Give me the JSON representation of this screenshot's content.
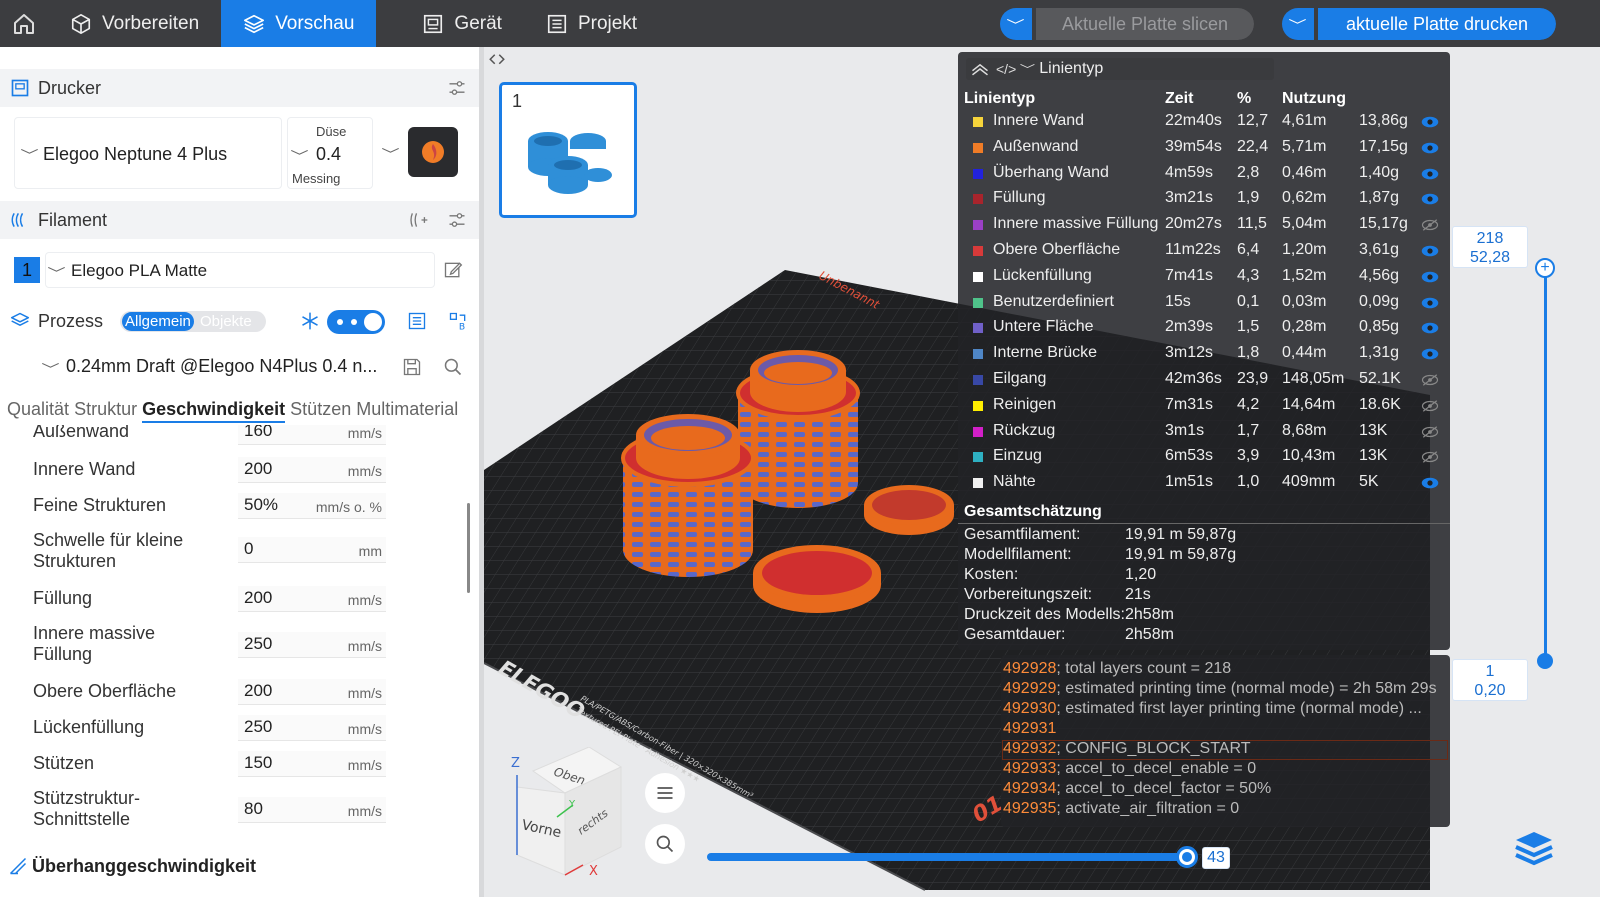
{
  "topbar": {
    "tabs": [
      {
        "label": "Vorbereiten",
        "active": false
      },
      {
        "label": "Vorschau",
        "active": true
      },
      {
        "label": "Gerät",
        "active": false
      },
      {
        "label": "Projekt",
        "active": false
      }
    ],
    "slice_label": "Aktuelle Platte slicen",
    "print_label": "aktuelle Platte drucken"
  },
  "printer": {
    "title": "Drucker",
    "name": "Elegoo Neptune 4 Plus",
    "nozzle_label": "Düse",
    "nozzle_value": "0.4",
    "nozzle_material": "Messing"
  },
  "filament": {
    "title": "Filament",
    "slot": "1",
    "name": "Elegoo PLA Matte"
  },
  "process": {
    "title": "Prozess",
    "mode_global": "Allgemein",
    "mode_objects": "Objekte",
    "profile": "0.24mm Draft @Elegoo N4Plus 0.4 n...",
    "tabs": [
      {
        "label": "Qualität",
        "active": false
      },
      {
        "label": "Struktur",
        "active": false
      },
      {
        "label": "Geschwindigkeit",
        "active": true
      },
      {
        "label": "Stützen",
        "active": false
      },
      {
        "label": "Multimaterial",
        "active": false
      }
    ],
    "settings": [
      {
        "label": "Außenwand",
        "value": "160",
        "unit": "mm/s"
      },
      {
        "label": "Innere Wand",
        "value": "200",
        "unit": "mm/s"
      },
      {
        "label": "Feine Strukturen",
        "value": "50%",
        "unit": "mm/s o. %"
      },
      {
        "label": "Schwelle für kleine Strukturen",
        "value": "0",
        "unit": "mm"
      },
      {
        "label": "Füllung",
        "value": "200",
        "unit": "mm/s"
      },
      {
        "label": "Innere massive Füllung",
        "value": "250",
        "unit": "mm/s"
      },
      {
        "label": "Obere Oberfläche",
        "value": "200",
        "unit": "mm/s"
      },
      {
        "label": "Lückenfüllung",
        "value": "250",
        "unit": "mm/s"
      },
      {
        "label": "Stützen",
        "value": "150",
        "unit": "mm/s"
      },
      {
        "label": "Stützstruktur-Schnittstelle",
        "value": "80",
        "unit": "mm/s"
      }
    ],
    "overhang_title": "Überhanggeschwindigkeit"
  },
  "plate": {
    "number": "1"
  },
  "viewport": {
    "plate_brand": "ELEGOO",
    "plate_sub1": "PLA/PETG/ABS/Carbon-Fiber | 320×320×385mm³",
    "plate_sub2": "Textured PEI Plate · Adhesion ★★★",
    "plate_name": "Unbenannt",
    "cube": {
      "top": "Oben",
      "front": "Vorne",
      "right": "rechts",
      "axis_z": "Z",
      "axis_x": "X",
      "axis_y": "Y"
    },
    "h_slider_value": "43"
  },
  "legend": {
    "dropdown": "Linientyp",
    "headers": {
      "type": "Linientyp",
      "time": "Zeit",
      "pct": "%",
      "usage": "Nutzung"
    },
    "rows": [
      {
        "name": "Innere Wand",
        "time": "22m40s",
        "pct": "12,7",
        "len": "4,61m",
        "weight": "13,86g",
        "color": "#f6d43b",
        "visible": true
      },
      {
        "name": "Außenwand",
        "time": "39m54s",
        "pct": "22,4",
        "len": "5,71m",
        "weight": "17,15g",
        "color": "#f07c27",
        "visible": true
      },
      {
        "name": "Überhang Wand",
        "time": "4m59s",
        "pct": "2,8",
        "len": "0,46m",
        "weight": "1,40g",
        "color": "#2222dd",
        "visible": true
      },
      {
        "name": "Füllung",
        "time": "3m21s",
        "pct": "1,9",
        "len": "0,62m",
        "weight": "1,87g",
        "color": "#a8242c",
        "visible": true
      },
      {
        "name": "Innere massive Füllung",
        "time": "20m27s",
        "pct": "11,5",
        "len": "5,04m",
        "weight": "15,17g",
        "color": "#9b40c6",
        "visible": false
      },
      {
        "name": "Obere Oberfläche",
        "time": "11m22s",
        "pct": "6,4",
        "len": "1,20m",
        "weight": "3,61g",
        "color": "#d83a3a",
        "visible": true
      },
      {
        "name": "Lückenfüllung",
        "time": "7m41s",
        "pct": "4,3",
        "len": "1,52m",
        "weight": "4,56g",
        "color": "#ffffff",
        "visible": true
      },
      {
        "name": "Benutzerdefiniert",
        "time": "15s",
        "pct": "0,1",
        "len": "0,03m",
        "weight": "0,09g",
        "color": "#4fc38a",
        "visible": true
      },
      {
        "name": "Untere Fläche",
        "time": "2m39s",
        "pct": "1,5",
        "len": "0,28m",
        "weight": "0,85g",
        "color": "#7060c8",
        "visible": true
      },
      {
        "name": "Interne Brücke",
        "time": "3m12s",
        "pct": "1,8",
        "len": "0,44m",
        "weight": "1,31g",
        "color": "#4f86c6",
        "visible": true
      },
      {
        "name": "Eilgang",
        "time": "42m36s",
        "pct": "23,9",
        "len": "148,05m",
        "weight": "52.1K",
        "color": "#3848a6",
        "visible": false
      },
      {
        "name": "Reinigen",
        "time": "7m31s",
        "pct": "4,2",
        "len": "14,64m",
        "weight": "18.6K",
        "color": "#ffee00",
        "visible": false
      },
      {
        "name": "Rückzug",
        "time": "3m1s",
        "pct": "1,7",
        "len": "8,68m",
        "weight": "13K",
        "color": "#d21fc8",
        "visible": false
      },
      {
        "name": "Einzug",
        "time": "6m53s",
        "pct": "3,9",
        "len": "10,43m",
        "weight": "13K",
        "color": "#2eb0c2",
        "visible": false
      },
      {
        "name": "Nähte",
        "time": "1m51s",
        "pct": "1,0",
        "len": "409mm",
        "weight": "5K",
        "color": "#f0f0f0",
        "visible": true
      }
    ],
    "summary_title": "Gesamtschätzung",
    "summary": [
      {
        "label": "Gesamtfilament:",
        "value": "19,91 m  59,87g"
      },
      {
        "label": "Modellfilament:",
        "value": "19,91 m  59,87g"
      },
      {
        "label": "Kosten:",
        "value": "1,20"
      },
      {
        "label": "Vorbereitungszeit:",
        "value": "21s"
      },
      {
        "label": "Druckzeit des Modells:",
        "value": "2h58m"
      },
      {
        "label": "Gesamtdauer:",
        "value": "2h58m"
      }
    ]
  },
  "gcode": [
    {
      "num": "492928",
      "text": "; total layers count = 218"
    },
    {
      "num": "492929",
      "text": "; estimated printing time (normal mode) = 2h 58m 29s"
    },
    {
      "num": "492930",
      "text": "; estimated first layer printing time (normal mode) ..."
    },
    {
      "num": "492931",
      "text": ""
    },
    {
      "num": "492932",
      "text": "; CONFIG_BLOCK_START"
    },
    {
      "num": "492933",
      "text": "; accel_to_decel_enable = 0"
    },
    {
      "num": "492934",
      "text": "; accel_to_decel_factor = 50%"
    },
    {
      "num": "492935",
      "text": "; activate_air_filtration = 0"
    }
  ],
  "layer_slider": {
    "top_layer": "218",
    "top_height": "52,28",
    "bottom_layer": "1",
    "bottom_height": "0,20"
  }
}
